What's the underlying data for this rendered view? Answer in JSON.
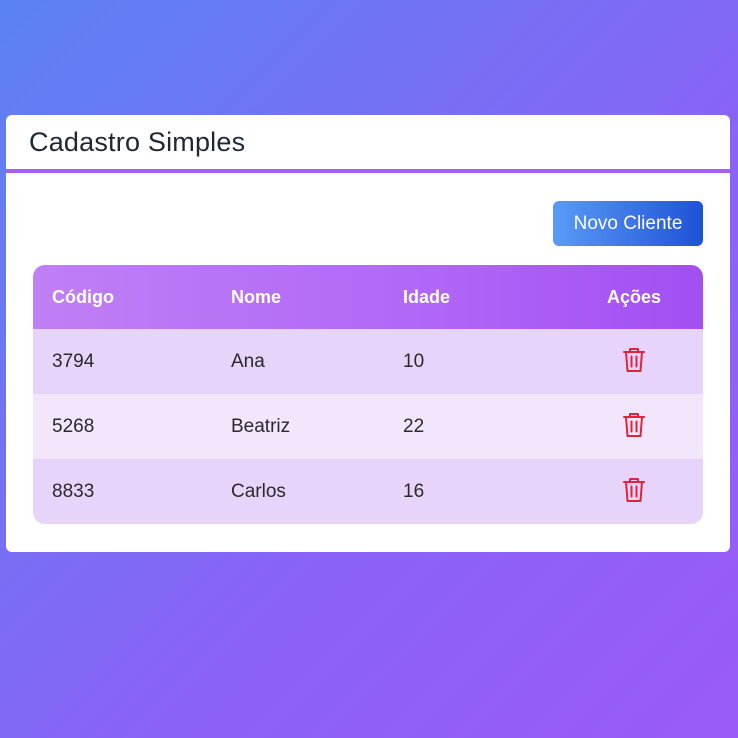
{
  "app": {
    "title": "Cadastro Simples"
  },
  "toolbar": {
    "new_client_label": "Novo Cliente"
  },
  "table": {
    "headers": [
      "Código",
      "Nome",
      "Idade",
      "Ações"
    ],
    "rows": [
      {
        "codigo": "3794",
        "nome": "Ana",
        "idade": "10",
        "action_icon": "trash-icon"
      },
      {
        "codigo": "5268",
        "nome": "Beatriz",
        "idade": "22",
        "action_icon": "trash-icon"
      },
      {
        "codigo": "8833",
        "nome": "Carlos",
        "idade": "16",
        "action_icon": "trash-icon"
      }
    ]
  },
  "colors": {
    "accent": "#a45ff0",
    "button_start": "#5a9bf7",
    "button_end": "#1f52d6",
    "delete_icon": "#e0243c",
    "row_odd": "#e7d4fb",
    "row_even": "#f2e6fd"
  }
}
